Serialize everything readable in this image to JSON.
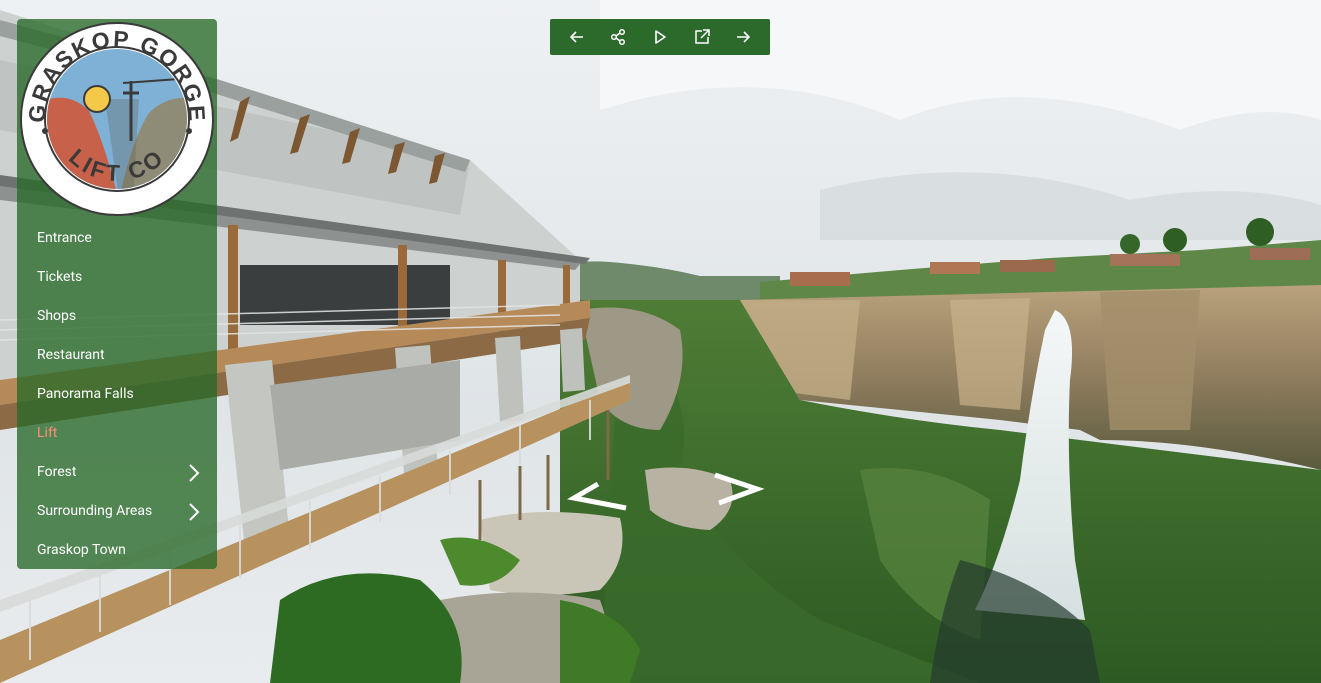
{
  "brand": {
    "logo_top_text": "GRASKOP GORGE",
    "logo_bottom_text": "LIFT CO"
  },
  "colors": {
    "sidebar_bg": "#286928",
    "toolbar_bg": "#2b6a2a",
    "active_menu_text": "#ff8c78"
  },
  "menu": {
    "items": [
      {
        "label": "Entrance",
        "active": false,
        "submenu": false
      },
      {
        "label": "Tickets",
        "active": false,
        "submenu": false
      },
      {
        "label": "Shops",
        "active": false,
        "submenu": false
      },
      {
        "label": "Restaurant",
        "active": false,
        "submenu": false
      },
      {
        "label": "Panorama Falls",
        "active": false,
        "submenu": false
      },
      {
        "label": "Lift",
        "active": true,
        "submenu": false
      },
      {
        "label": "Forest",
        "active": false,
        "submenu": true
      },
      {
        "label": "Surrounding Areas",
        "active": false,
        "submenu": true
      },
      {
        "label": "Graskop Town",
        "active": false,
        "submenu": false
      }
    ]
  },
  "toolbar": {
    "buttons": [
      {
        "icon": "arrow-left-icon"
      },
      {
        "icon": "share-icon"
      },
      {
        "icon": "play-icon"
      },
      {
        "icon": "external-link-icon"
      },
      {
        "icon": "arrow-right-icon"
      }
    ]
  },
  "hotspots": [
    {
      "icon": "chevron-left-icon"
    },
    {
      "icon": "chevron-right-icon"
    }
  ]
}
